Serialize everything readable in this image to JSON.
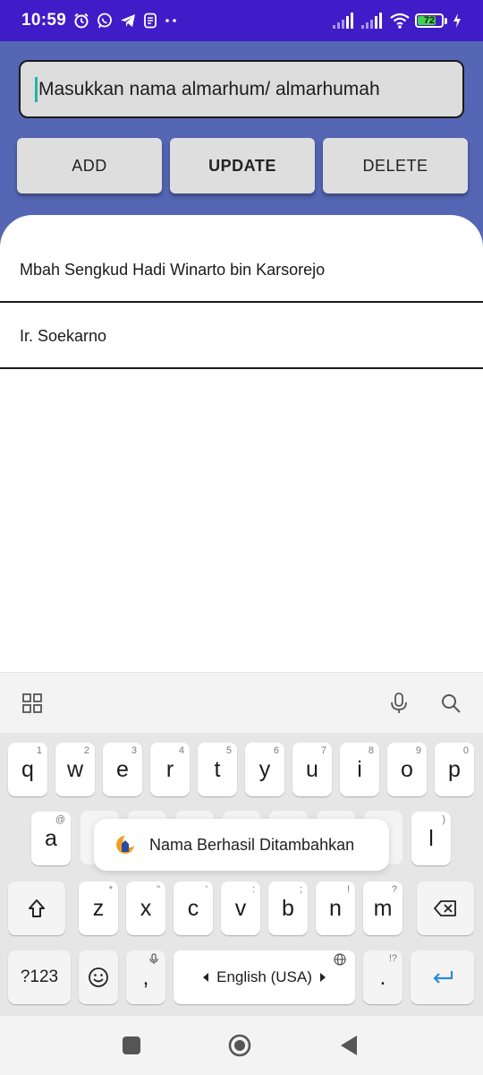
{
  "status_bar": {
    "time": "10:59",
    "battery": "72",
    "left_icons": [
      "alarm-icon",
      "whatsapp-icon",
      "telegram-icon",
      "app-icon",
      "more-dots-icon"
    ],
    "right_icons": [
      "signal-icon",
      "signal-icon",
      "wifi-icon",
      "battery-icon",
      "charging-icon"
    ]
  },
  "form": {
    "name_input_placeholder": "Masukkan nama almarhum/ almarhumah",
    "add_label": "ADD",
    "update_label": "UPDATE",
    "delete_label": "DELETE"
  },
  "list": {
    "items": [
      "Mbah Sengkud Hadi Winarto bin Karsorejo",
      "Ir. Soekarno"
    ]
  },
  "toast": {
    "message": "Nama Berhasil Ditambahkan"
  },
  "keyboard": {
    "row1": [
      {
        "key": "q",
        "hint": "1"
      },
      {
        "key": "w",
        "hint": "2"
      },
      {
        "key": "e",
        "hint": "3"
      },
      {
        "key": "r",
        "hint": "4"
      },
      {
        "key": "t",
        "hint": "5"
      },
      {
        "key": "y",
        "hint": "6"
      },
      {
        "key": "u",
        "hint": "7"
      },
      {
        "key": "i",
        "hint": "8"
      },
      {
        "key": "o",
        "hint": "9"
      },
      {
        "key": "p",
        "hint": "0"
      }
    ],
    "row2_visible": [
      {
        "key": "a",
        "hint": "@"
      },
      {
        "key": "l",
        "hint": ")"
      }
    ],
    "row3": [
      {
        "key": "z",
        "hint": "*"
      },
      {
        "key": "x",
        "hint": "\""
      },
      {
        "key": "c",
        "hint": "'"
      },
      {
        "key": "v",
        "hint": ":"
      },
      {
        "key": "b",
        "hint": ";"
      },
      {
        "key": "n",
        "hint": "!"
      },
      {
        "key": "m",
        "hint": "?"
      }
    ],
    "symbols_label": "?123",
    "comma_label": ",",
    "space_label": "English (USA)",
    "period_label": ".",
    "period_hint": "!?"
  }
}
